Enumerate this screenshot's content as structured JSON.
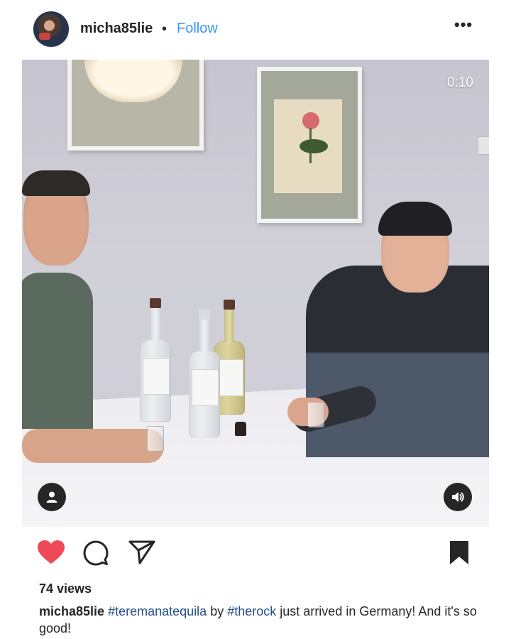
{
  "post": {
    "username": "micha85lie",
    "separator": "•",
    "follow_label": "Follow",
    "more_label": "•••"
  },
  "video": {
    "timestamp": "0:10"
  },
  "icons": {
    "like": "heart-icon",
    "comment": "comment-icon",
    "share": "paper-plane-icon",
    "save": "bookmark-icon",
    "user_tag": "user-icon",
    "audio": "speaker-icon"
  },
  "colors": {
    "like_red": "#ed4956",
    "follow_blue": "#3897f0",
    "hashtag_blue": "#234f8c"
  },
  "stats": {
    "views": "74 views"
  },
  "caption": {
    "username": "micha85lie",
    "hashtag1": "#teremanatequila",
    "text_by": "by",
    "hashtag2": "#therock",
    "text_rest": "just arrived in Germany! And it's so good!"
  }
}
